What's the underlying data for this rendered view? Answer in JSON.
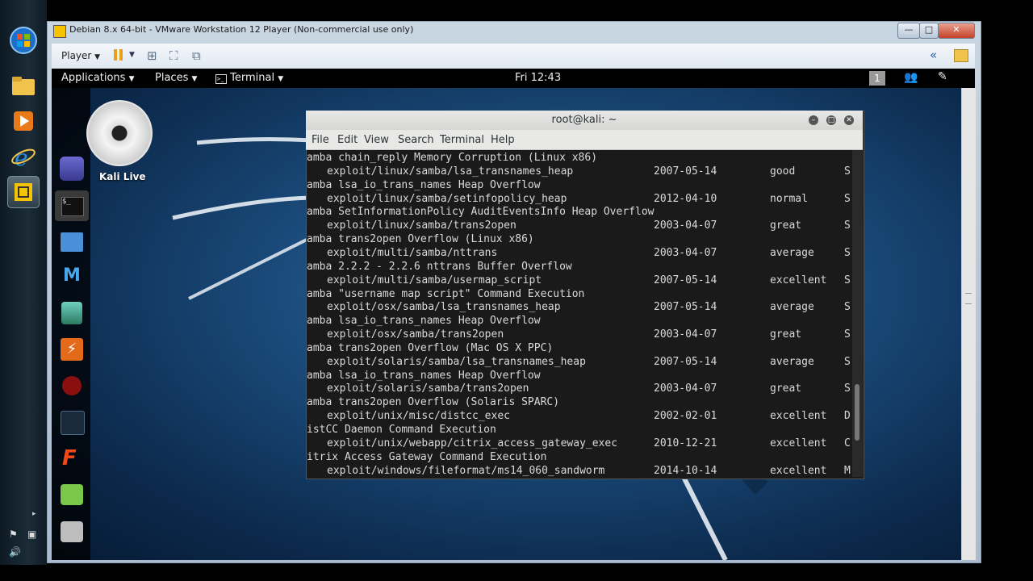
{
  "vm_window": {
    "title": "Debian 8.x 64-bit - VMware Workstation 12 Player (Non-commercial use only)",
    "player_label": "Player",
    "controls": {
      "minimize": "—",
      "maximize": "□",
      "close": "✕"
    }
  },
  "gnome_bar": {
    "applications": "Applications",
    "places": "Places",
    "terminal": "Terminal",
    "clock": "Fri 12:43",
    "workspace": "1"
  },
  "desktop": {
    "kali_live_label": "Kali Live"
  },
  "terminal": {
    "title": "root@kali: ~",
    "menu": [
      "File",
      "Edit",
      "View",
      "Search",
      "Terminal",
      "Help"
    ],
    "lines": [
      {
        "desc": "amba chain_reply Memory Corruption (Linux x86)"
      },
      {
        "path": "exploit/linux/samba/lsa_transnames_heap",
        "date": "2007-05-14",
        "rank": "good",
        "check": "S"
      },
      {
        "desc": "amba lsa_io_trans_names Heap Overflow"
      },
      {
        "path": "exploit/linux/samba/setinfopolicy_heap",
        "date": "2012-04-10",
        "rank": "normal",
        "check": "S"
      },
      {
        "desc": "amba SetInformationPolicy AuditEventsInfo Heap Overflow"
      },
      {
        "path": "exploit/linux/samba/trans2open",
        "date": "2003-04-07",
        "rank": "great",
        "check": "S"
      },
      {
        "desc": "amba trans2open Overflow (Linux x86)"
      },
      {
        "path": "exploit/multi/samba/nttrans",
        "date": "2003-04-07",
        "rank": "average",
        "check": "S"
      },
      {
        "desc": "amba 2.2.2 - 2.2.6 nttrans Buffer Overflow"
      },
      {
        "path": "exploit/multi/samba/usermap_script",
        "date": "2007-05-14",
        "rank": "excellent",
        "check": "S"
      },
      {
        "desc": "amba \"username map script\" Command Execution"
      },
      {
        "path": "exploit/osx/samba/lsa_transnames_heap",
        "date": "2007-05-14",
        "rank": "average",
        "check": "S"
      },
      {
        "desc": "amba lsa_io_trans_names Heap Overflow"
      },
      {
        "path": "exploit/osx/samba/trans2open",
        "date": "2003-04-07",
        "rank": "great",
        "check": "S"
      },
      {
        "desc": "amba trans2open Overflow (Mac OS X PPC)"
      },
      {
        "path": "exploit/solaris/samba/lsa_transnames_heap",
        "date": "2007-05-14",
        "rank": "average",
        "check": "S"
      },
      {
        "desc": "amba lsa_io_trans_names Heap Overflow"
      },
      {
        "path": "exploit/solaris/samba/trans2open",
        "date": "2003-04-07",
        "rank": "great",
        "check": "S"
      },
      {
        "desc": "amba trans2open Overflow (Solaris SPARC)"
      },
      {
        "path": "exploit/unix/misc/distcc_exec",
        "date": "2002-02-01",
        "rank": "excellent",
        "check": "D"
      },
      {
        "desc": "istCC Daemon Command Execution"
      },
      {
        "path": "exploit/unix/webapp/citrix_access_gateway_exec",
        "date": "2010-12-21",
        "rank": "excellent",
        "check": "C"
      },
      {
        "desc": "itrix Access Gateway Command Execution"
      },
      {
        "path": "exploit/windows/fileformat/ms14_060_sandworm",
        "date": "2014-10-14",
        "rank": "excellent",
        "check": "M"
      }
    ]
  }
}
